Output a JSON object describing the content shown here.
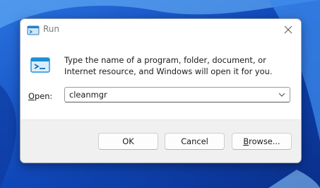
{
  "window": {
    "title": "Run",
    "icon": "run-icon",
    "close_icon": "close-icon"
  },
  "content": {
    "icon": "run-icon",
    "description": "Type the name of a program, folder, document, or Internet resource, and Windows will open it for you.",
    "open_label_mnemonic": "O",
    "open_label_rest": "pen:",
    "open_value": "cleanmgr",
    "dropdown_icon": "chevron-down-icon"
  },
  "buttons": {
    "ok_label": "OK",
    "cancel_label": "Cancel",
    "browse_mnemonic": "B",
    "browse_rest": "rowse..."
  },
  "colors": {
    "wallpaper": "#1a5bc8",
    "dialog_bg": "#ffffff",
    "footer_bg": "#f0f0f0",
    "icon_accent": "#1e8fd6"
  }
}
